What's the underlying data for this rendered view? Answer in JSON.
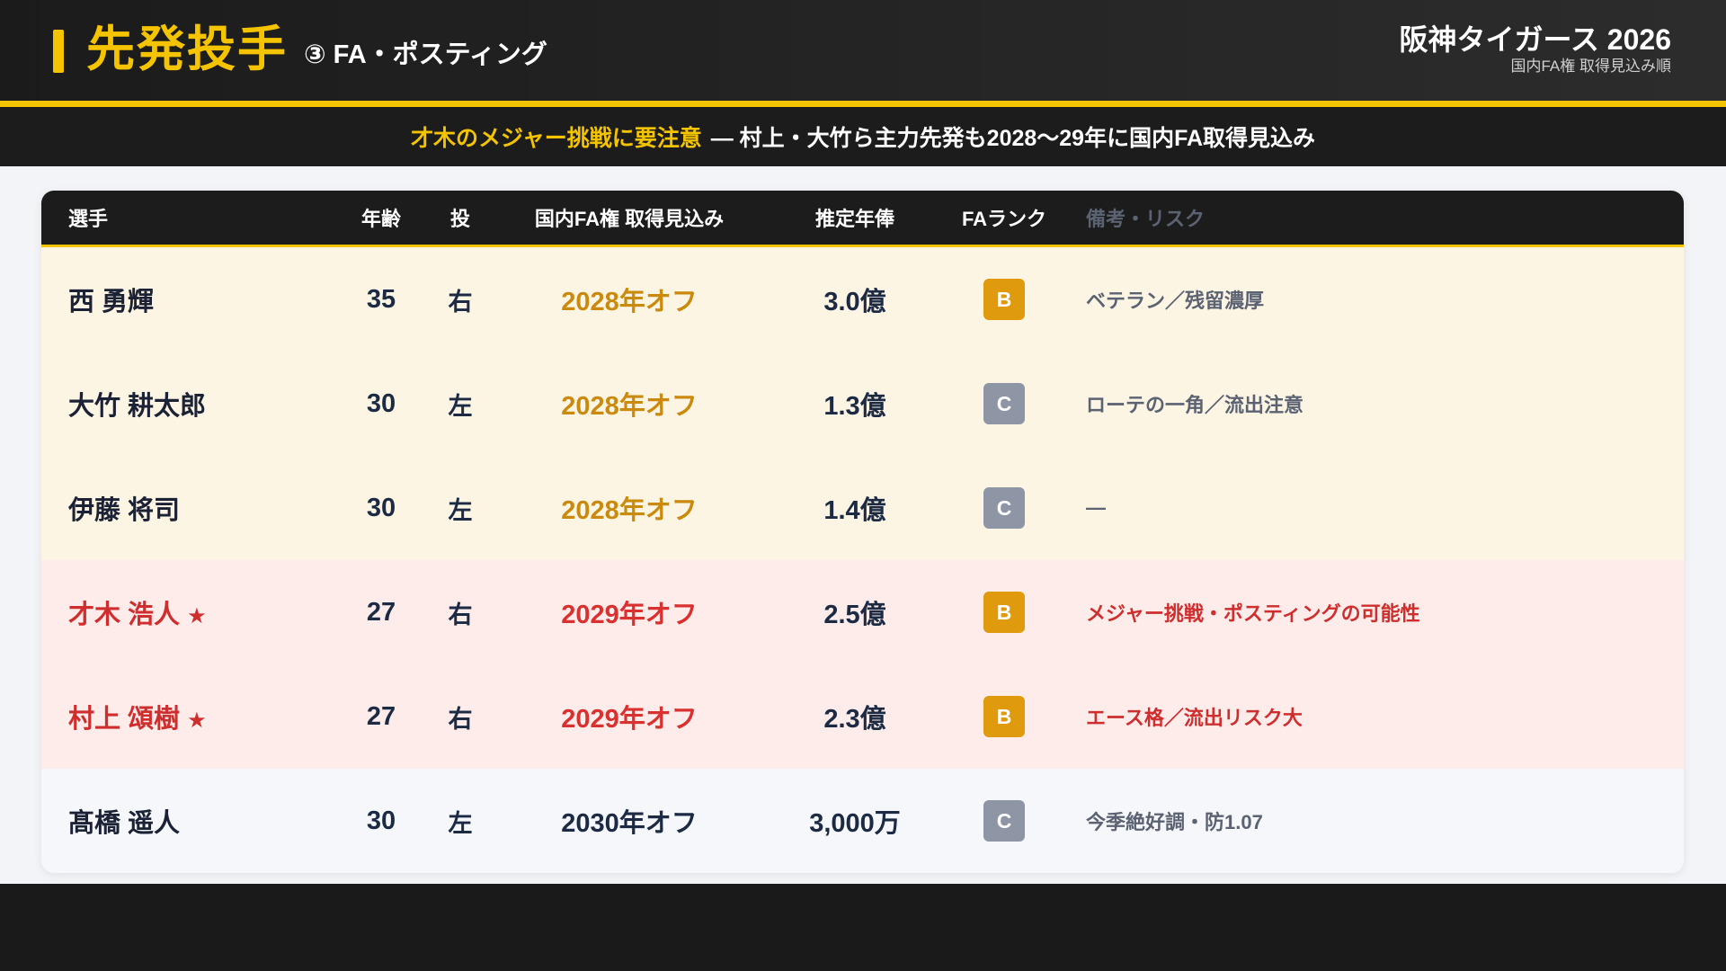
{
  "header": {
    "title": "先発投手",
    "subtitle": "③ FA・ポスティング",
    "team": "阪神タイガース 2026",
    "sort_note": "国内FA権 取得見込み順"
  },
  "banner": {
    "highlight": "才木のメジャー挑戦に要注意",
    "text": "— 村上・大竹ら主力先発も2028〜29年に国内FA取得見込み"
  },
  "colors": {
    "accent": "#f5c400",
    "rank_B": "#e09a0e",
    "rank_C": "#8e96a6"
  },
  "table": {
    "columns": [
      "選手",
      "年齢",
      "投",
      "国内FA権 取得見込み",
      "推定年俸",
      "FAランク",
      "備考・リスク"
    ],
    "rows": [
      {
        "name": "西 勇輝",
        "star": "",
        "age": "35",
        "hand": "右",
        "fa": "2028年オフ",
        "salary": "3.0億",
        "rank": "B",
        "note": "ベテラン／残留濃厚",
        "bg": "#fdf5e4",
        "name_color": "#1c2235",
        "fa_color": "#c98a0e",
        "note_color": "#5b6272"
      },
      {
        "name": "大竹 耕太郎",
        "star": "",
        "age": "30",
        "hand": "左",
        "fa": "2028年オフ",
        "salary": "1.3億",
        "rank": "C",
        "note": "ローテの一角／流出注意",
        "bg": "#fdf5e4",
        "name_color": "#1c2235",
        "fa_color": "#c98a0e",
        "note_color": "#5b6272"
      },
      {
        "name": "伊藤 将司",
        "star": "",
        "age": "30",
        "hand": "左",
        "fa": "2028年オフ",
        "salary": "1.4億",
        "rank": "C",
        "note": "—",
        "bg": "#fdf5e4",
        "name_color": "#1c2235",
        "fa_color": "#c98a0e",
        "note_color": "#5b6272"
      },
      {
        "name": "才木 浩人",
        "star": "★",
        "age": "27",
        "hand": "右",
        "fa": "2029年オフ",
        "salary": "2.5億",
        "rank": "B",
        "note": "メジャー挑戦・ポスティングの可能性",
        "bg": "#fdecea",
        "name_color": "#cf2e2e",
        "fa_color": "#d93030",
        "note_color": "#cf2e2e"
      },
      {
        "name": "村上 頌樹",
        "star": "★",
        "age": "27",
        "hand": "右",
        "fa": "2029年オフ",
        "salary": "2.3億",
        "rank": "B",
        "note": "エース格／流出リスク大",
        "bg": "#fdecea",
        "name_color": "#cf2e2e",
        "fa_color": "#d93030",
        "note_color": "#cf2e2e"
      },
      {
        "name": "髙橋 遥人",
        "star": "",
        "age": "30",
        "hand": "左",
        "fa": "2030年オフ",
        "salary": "3,000万",
        "rank": "C",
        "note": "今季絶好調・防1.07",
        "bg": "#f6f7fa",
        "name_color": "#1c2235",
        "fa_color": "#1c2a44",
        "note_color": "#5b6272"
      }
    ]
  }
}
